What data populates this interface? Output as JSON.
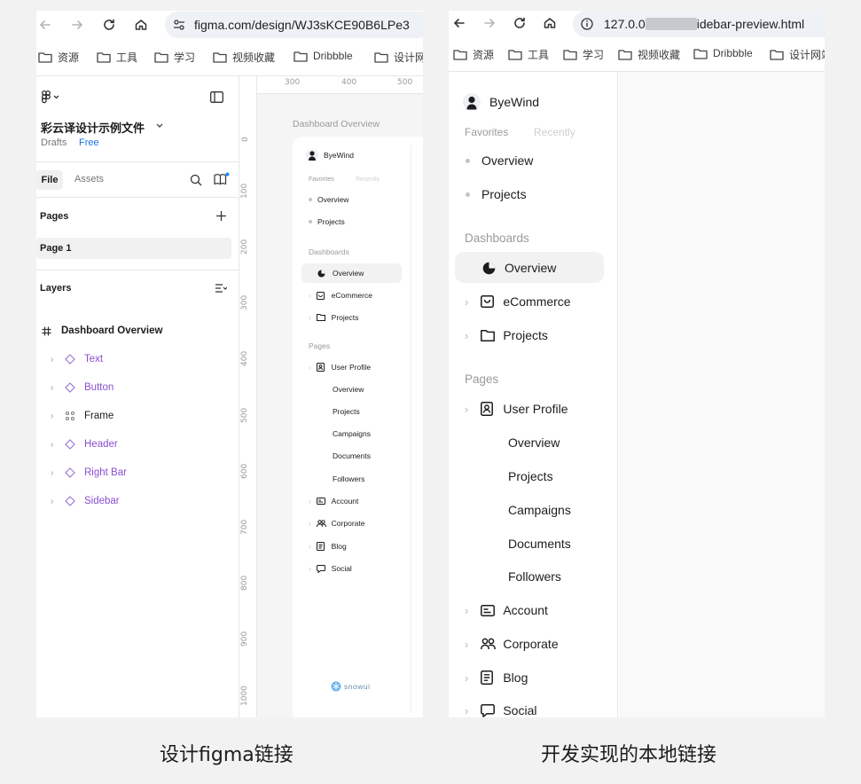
{
  "left_browser": {
    "url": "figma.com/design/WJ3sKCE90B6LPe3",
    "bookmarks": [
      "资源",
      "工具",
      "学习",
      "视频收藏",
      "Dribbble",
      "设计网"
    ]
  },
  "figma": {
    "file_title": "彩云译设计示例文件",
    "drafts_label": "Drafts",
    "plan_badge": "Free",
    "tabs": {
      "file": "File",
      "assets": "Assets"
    },
    "pages_heading": "Pages",
    "current_page": "Page 1",
    "layers_heading": "Layers",
    "frame_name": "Dashboard Overview",
    "layers": [
      {
        "name": "Text",
        "kind": "component"
      },
      {
        "name": "Button",
        "kind": "component"
      },
      {
        "name": "Frame",
        "kind": "frame"
      },
      {
        "name": "Header",
        "kind": "component"
      },
      {
        "name": "Right Bar",
        "kind": "component"
      },
      {
        "name": "Sidebar",
        "kind": "component"
      }
    ],
    "ruler_top": [
      "300",
      "400",
      "500"
    ],
    "ruler_left": [
      "0",
      "100",
      "200",
      "300",
      "400",
      "500",
      "600",
      "700",
      "800",
      "900",
      "1000"
    ],
    "canvas_frame_label": "Dashboard Overview",
    "footer_logo": "snowui"
  },
  "right_browser": {
    "url_prefix": "127.0.0",
    "url_suffix": "idebar-preview.html",
    "bookmarks": [
      "资源",
      "工具",
      "学习",
      "视频收藏",
      "Dribbble",
      "设计网站"
    ]
  },
  "sidebar": {
    "brand": "ByeWind",
    "tabs": [
      "Favorites",
      "Recently"
    ],
    "favorites": [
      "Overview",
      "Projects"
    ],
    "dashboards_heading": "Dashboards",
    "dashboards": [
      {
        "label": "Overview",
        "icon": "pie-chart-icon",
        "active": true
      },
      {
        "label": "eCommerce",
        "icon": "shopping-bag-icon"
      },
      {
        "label": "Projects",
        "icon": "folder-icon"
      }
    ],
    "pages_heading": "Pages",
    "user_profile": "User Profile",
    "user_profile_children": [
      "Overview",
      "Projects",
      "Campaigns",
      "Documents",
      "Followers"
    ],
    "other_pages": [
      {
        "label": "Account",
        "icon": "id-card-icon"
      },
      {
        "label": "Corporate",
        "icon": "users-icon"
      },
      {
        "label": "Blog",
        "icon": "notebook-icon"
      },
      {
        "label": "Social",
        "icon": "chat-bubble-icon"
      }
    ]
  },
  "captions": {
    "left": "设计figma链接",
    "right": "开发实现的本地链接"
  },
  "colors": {
    "accent_purple": "#8a4fd1",
    "free_badge": "#1a73e8",
    "active_row": "#f2f2f2"
  }
}
